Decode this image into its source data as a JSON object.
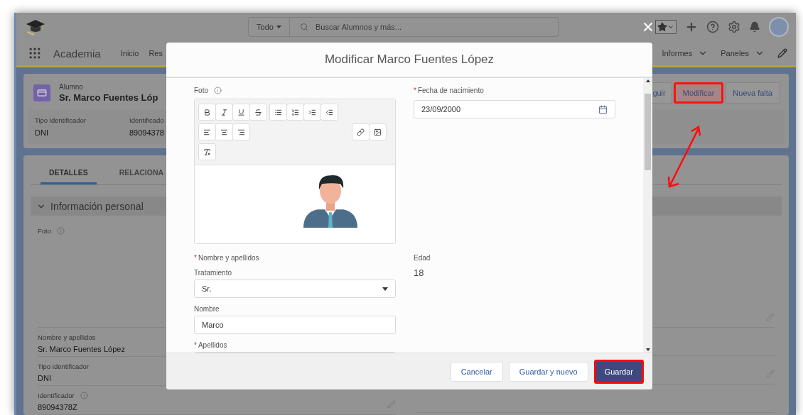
{
  "header": {
    "search_scope": "Todo",
    "search_placeholder": "Buscar Alumnos y más..."
  },
  "nav": {
    "app_name": "Academia",
    "items_left": [
      {
        "label": "Inicio",
        "dropdown": false
      },
      {
        "label": "Res",
        "dropdown": false
      }
    ],
    "items_right": [
      {
        "label": "Informes",
        "dropdown": true
      },
      {
        "label": "Paneles",
        "dropdown": true
      }
    ]
  },
  "record": {
    "object_type": "Alumno",
    "name": "Sr. Marco Fuentes Lóp",
    "highlights": [
      {
        "label": "Tipo identificador",
        "value": "DNI"
      },
      {
        "label": "Identificado",
        "value": "89094378"
      }
    ],
    "actions": [
      {
        "label": "guir",
        "highlighted": false
      },
      {
        "label": "Modificar",
        "highlighted": true
      },
      {
        "label": "Nueva falta",
        "highlighted": false
      }
    ]
  },
  "tabs": [
    {
      "label": "DETALLES",
      "selected": true
    },
    {
      "label": "RELACIONA",
      "selected": false
    }
  ],
  "section": {
    "title": "Información personal",
    "expanded": true
  },
  "fields": [
    {
      "label": "Foto",
      "kind": "photo",
      "info": true
    },
    {
      "label": "Nombre y apellidos",
      "kind": "text",
      "value": "Sr. Marco Fuentes López",
      "info": false
    },
    {
      "label": "Tipo identificador",
      "kind": "text",
      "value": "DNI",
      "info": false
    },
    {
      "label": "Identificador",
      "kind": "text",
      "value": "89094378Z",
      "info": true
    }
  ],
  "modal": {
    "title": "Modificar Marco Fuentes López",
    "required_mark": "*",
    "photo": {
      "label": "Foto",
      "info": true
    },
    "left_fields": [
      {
        "label": "Nombre y apellidos",
        "kind": "heading",
        "required": true
      },
      {
        "label": "Tratamiento",
        "kind": "select",
        "value": "Sr.",
        "required": false
      },
      {
        "label": "Nombre",
        "kind": "input",
        "value": "Marco",
        "required": false
      },
      {
        "label": "Apellidos",
        "kind": "input",
        "required": true
      }
    ],
    "right_fields": [
      {
        "label": "Fecha de nacimiento",
        "kind": "date",
        "value": "23/09/2000",
        "required": true
      },
      {
        "label": "Edad",
        "kind": "readonly",
        "value": "18",
        "required": false
      }
    ],
    "buttons": [
      {
        "label": "Cancelar",
        "kind": "neutral",
        "highlighted": false
      },
      {
        "label": "Guardar y nuevo",
        "kind": "neutral",
        "highlighted": false
      },
      {
        "label": "Guardar",
        "kind": "brand",
        "highlighted": true
      }
    ]
  }
}
